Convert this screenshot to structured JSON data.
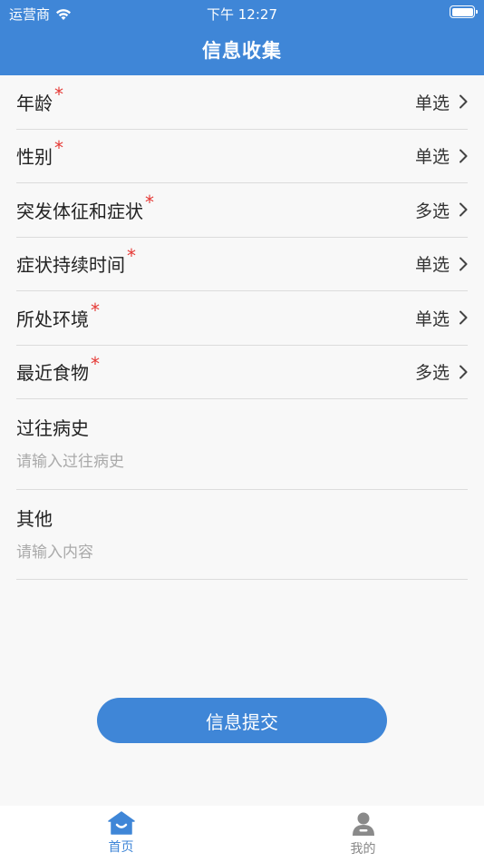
{
  "status_bar": {
    "carrier": "运营商",
    "time": "下午 12:27"
  },
  "header": {
    "title": "信息收集"
  },
  "form": {
    "rows": [
      {
        "label": "年龄",
        "required": "*",
        "value": "单选"
      },
      {
        "label": "性别",
        "required": "*",
        "value": "单选"
      },
      {
        "label": "突发体征和症状",
        "required": "*",
        "value": "多选"
      },
      {
        "label": "症状持续时间",
        "required": "*",
        "value": "单选"
      },
      {
        "label": "所处环境",
        "required": "*",
        "value": "单选"
      },
      {
        "label": "最近食物",
        "required": "*",
        "value": "多选"
      }
    ],
    "history": {
      "label": "过往病史",
      "placeholder": "请输入过往病史"
    },
    "other": {
      "label": "其他",
      "placeholder": "请输入内容"
    }
  },
  "submit_label": "信息提交",
  "tabbar": {
    "home": {
      "label": "首页",
      "icon": "home-icon"
    },
    "mine": {
      "label": "我的",
      "icon": "user-icon"
    }
  },
  "colors": {
    "primary": "#3f86d7",
    "required": "#e53935"
  }
}
